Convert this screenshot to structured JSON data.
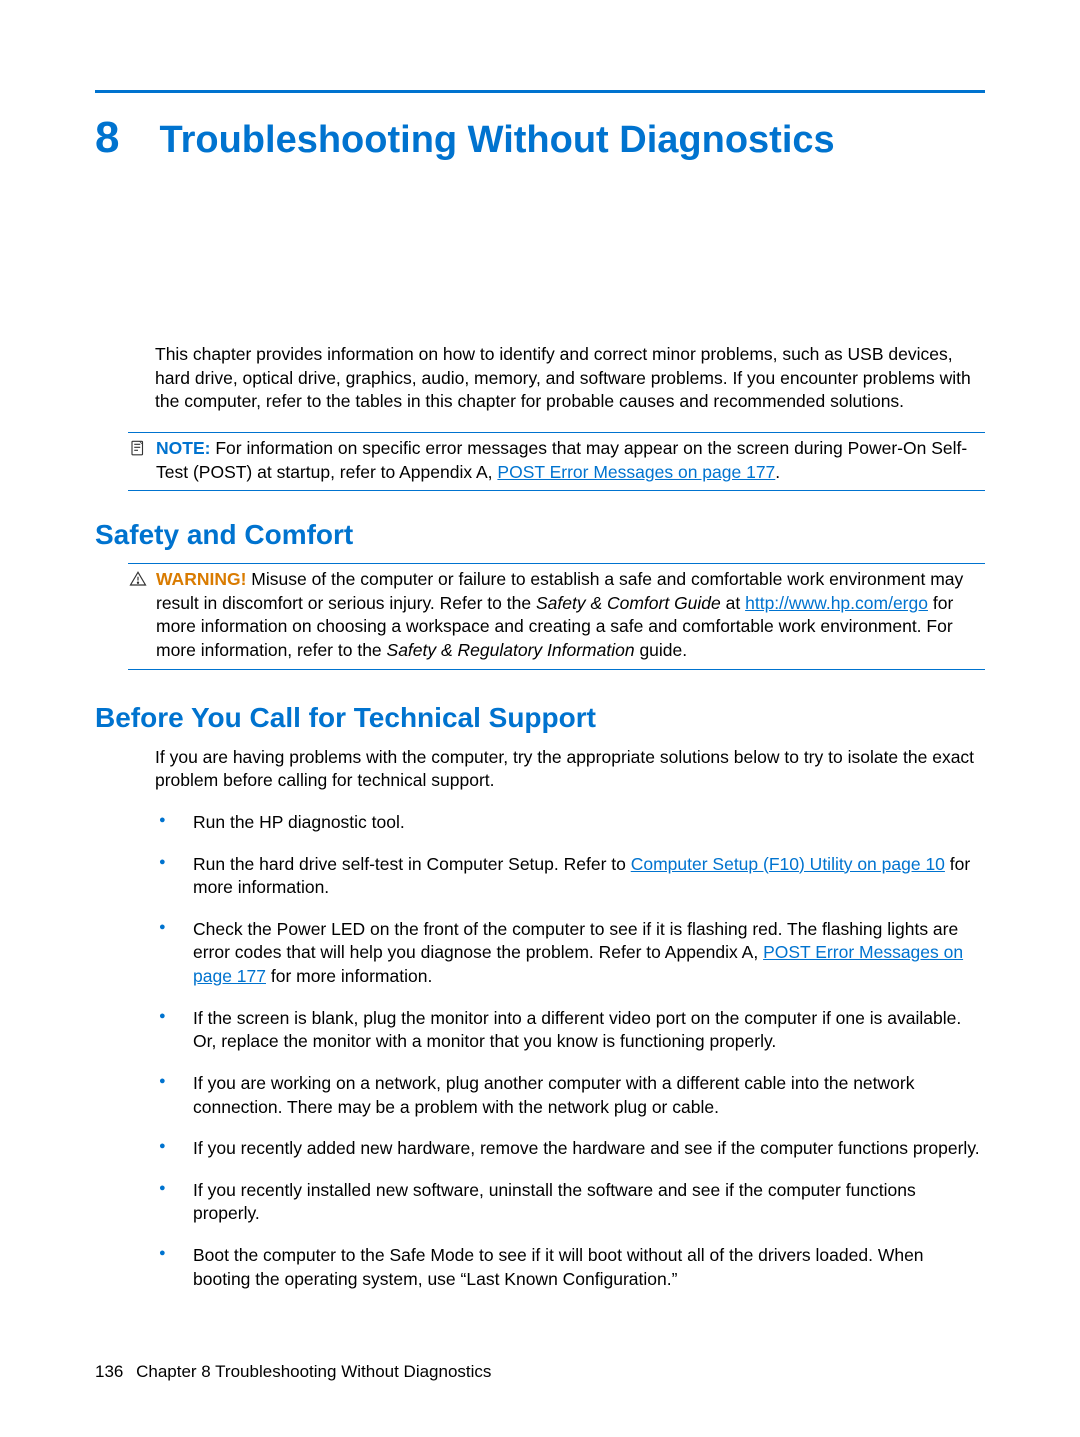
{
  "chapter": {
    "number": "8",
    "title": "Troubleshooting Without Diagnostics"
  },
  "intro": "This chapter provides information on how to identify and correct minor problems, such as USB devices, hard drive, optical drive, graphics, audio, memory, and software problems. If you encounter problems with the computer, refer to the tables in this chapter for probable causes and recommended solutions.",
  "note": {
    "label": "NOTE:",
    "text_before_link": "For information on specific error messages that may appear on the screen during Power-On Self-Test (POST) at startup, refer to Appendix A, ",
    "link": "POST Error Messages on page 177",
    "after": "."
  },
  "section_safety": {
    "heading": "Safety and Comfort",
    "warning_label": "WARNING!",
    "text1": "Misuse of the computer or failure to establish a safe and comfortable work environment may result in discomfort or serious injury. Refer to the ",
    "italic1": "Safety & Comfort Guide",
    "text2": " at ",
    "link": "http://www.hp.com/ergo",
    "text3": " for more information on choosing a workspace and creating a safe and comfortable work environment. For more information, refer to the ",
    "italic2": "Safety & Regulatory Information",
    "text4": " guide."
  },
  "section_support": {
    "heading": "Before You Call for Technical Support",
    "intro": "If you are having problems with the computer, try the appropriate solutions below to try to isolate the exact problem before calling for technical support.",
    "bullets": [
      {
        "pre": "Run the HP diagnostic tool."
      },
      {
        "pre": "Run the hard drive self-test in Computer Setup. Refer to ",
        "link": "Computer Setup (F10) Utility on page 10",
        "post": " for more information."
      },
      {
        "pre": "Check the Power LED on the front of the computer to see if it is flashing red. The flashing lights are error codes that will help you diagnose the problem. Refer to Appendix A, ",
        "link": "POST Error Messages on page 177",
        "post": " for more information."
      },
      {
        "pre": "If the screen is blank, plug the monitor into a different video port on the computer if one is available. Or, replace the monitor with a monitor that you know is functioning properly."
      },
      {
        "pre": "If you are working on a network, plug another computer with a different cable into the network connection. There may be a problem with the network plug or cable."
      },
      {
        "pre": "If you recently added new hardware, remove the hardware and see if the computer functions properly."
      },
      {
        "pre": "If you recently installed new software, uninstall the software and see if the computer functions properly."
      },
      {
        "pre": "Boot the computer to the Safe Mode to see if it will boot without all of the drivers loaded. When booting the operating system, use “Last Known Configuration.”"
      }
    ]
  },
  "footer": {
    "page_number": "136",
    "label": "Chapter 8   Troubleshooting Without Diagnostics"
  }
}
